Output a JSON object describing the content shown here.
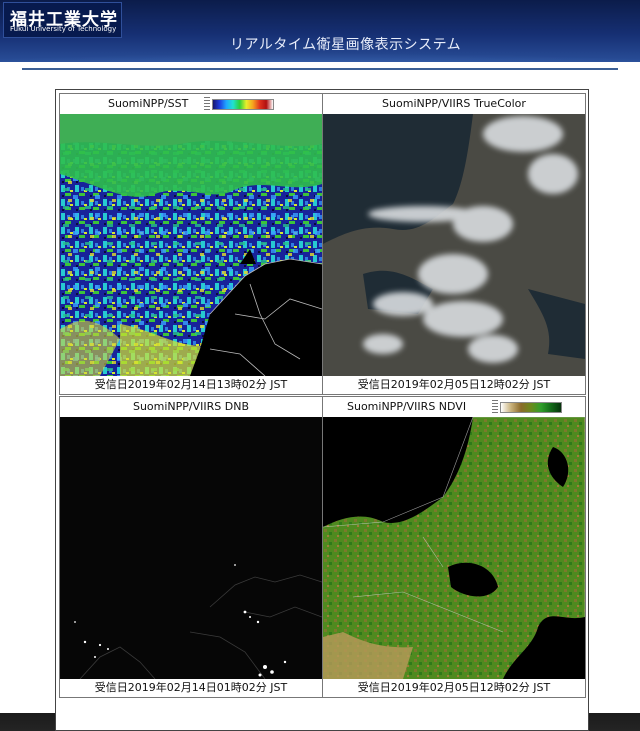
{
  "header": {
    "logo_jp": "福井工業大学",
    "logo_en": "Fukui University of Technology",
    "site_title": "リアルタイム衛星画像表示システム"
  },
  "panels": [
    {
      "title": "SuomiNPP/SST",
      "caption": "受信日2019年02月14日13時02分 JST"
    },
    {
      "title": "SuomiNPP/VIIRS TrueColor",
      "caption": "受信日2019年02月05日12時02分 JST"
    },
    {
      "title": "SuomiNPP/VIIRS DNB",
      "caption": "受信日2019年02月14日01時02分 JST"
    },
    {
      "title": "SuomiNPP/VIIRS NDVI",
      "caption": "受信日2019年02月05日12時02分 JST"
    }
  ],
  "colors": {
    "header_blue": "#162f73",
    "divider": "#3b5f95",
    "sst_sea": "#1a2aa8",
    "sst_warm": "#2ecf4a",
    "ndvi_vegetation": "#5b8f1f",
    "dnb_background": "#050505"
  }
}
